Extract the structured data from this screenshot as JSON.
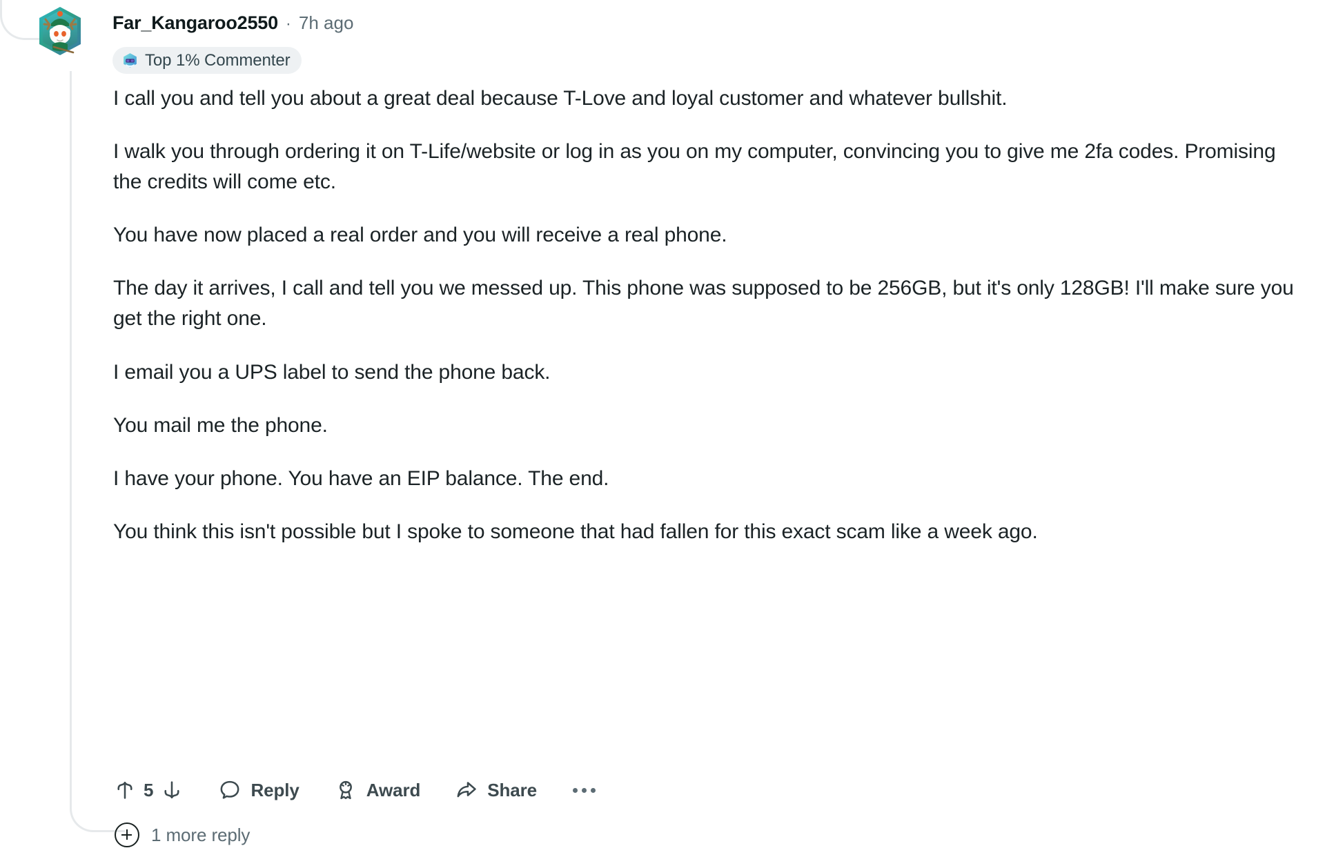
{
  "thread": {
    "line_color": "#e6e9eb"
  },
  "comment": {
    "author": "Far_Kangaroo2550",
    "separator": "·",
    "timestamp": "7h ago",
    "avatar_alt": "user-avatar",
    "badge": {
      "icon": "snoo-sunglasses-icon",
      "label": "Top 1% Commenter"
    },
    "paragraphs": [
      "I call you and tell you about a great deal because T-Love and loyal customer and whatever bullshit.",
      "I walk you through ordering it on T-Life/website or log in as you on my computer, convincing you to give me 2fa codes. Promising the credits will come etc.",
      "You have now placed a real order and you will receive a real phone.",
      "The day it arrives, I call and tell you we messed up. This phone was supposed to be 256GB, but it's only 128GB! I'll make sure you get the right one.",
      "I email you a UPS label to send the phone back.",
      "You mail me the phone.",
      "I have your phone. You have an EIP balance. The end.",
      "You think this isn't possible but I spoke to someone that had fallen for this exact scam like a week ago."
    ],
    "actions": {
      "upvote_icon": "upvote-arrow-icon",
      "score": "5",
      "downvote_icon": "downvote-arrow-icon",
      "reply_label": "Reply",
      "reply_icon": "comment-bubble-icon",
      "award_label": "Award",
      "award_icon": "award-medal-icon",
      "share_label": "Share",
      "share_icon": "share-arrow-icon",
      "more_icon": "overflow-menu-icon"
    },
    "more_replies": {
      "icon": "plus-circle-icon",
      "label": "1 more reply"
    }
  },
  "colors": {
    "text_primary": "#1b2326",
    "text_secondary": "#5c6c74",
    "text_action": "#3d4a4f",
    "badge_bg": "#eef1f3",
    "thread_line": "#e6e9eb",
    "background": "#ffffff"
  }
}
